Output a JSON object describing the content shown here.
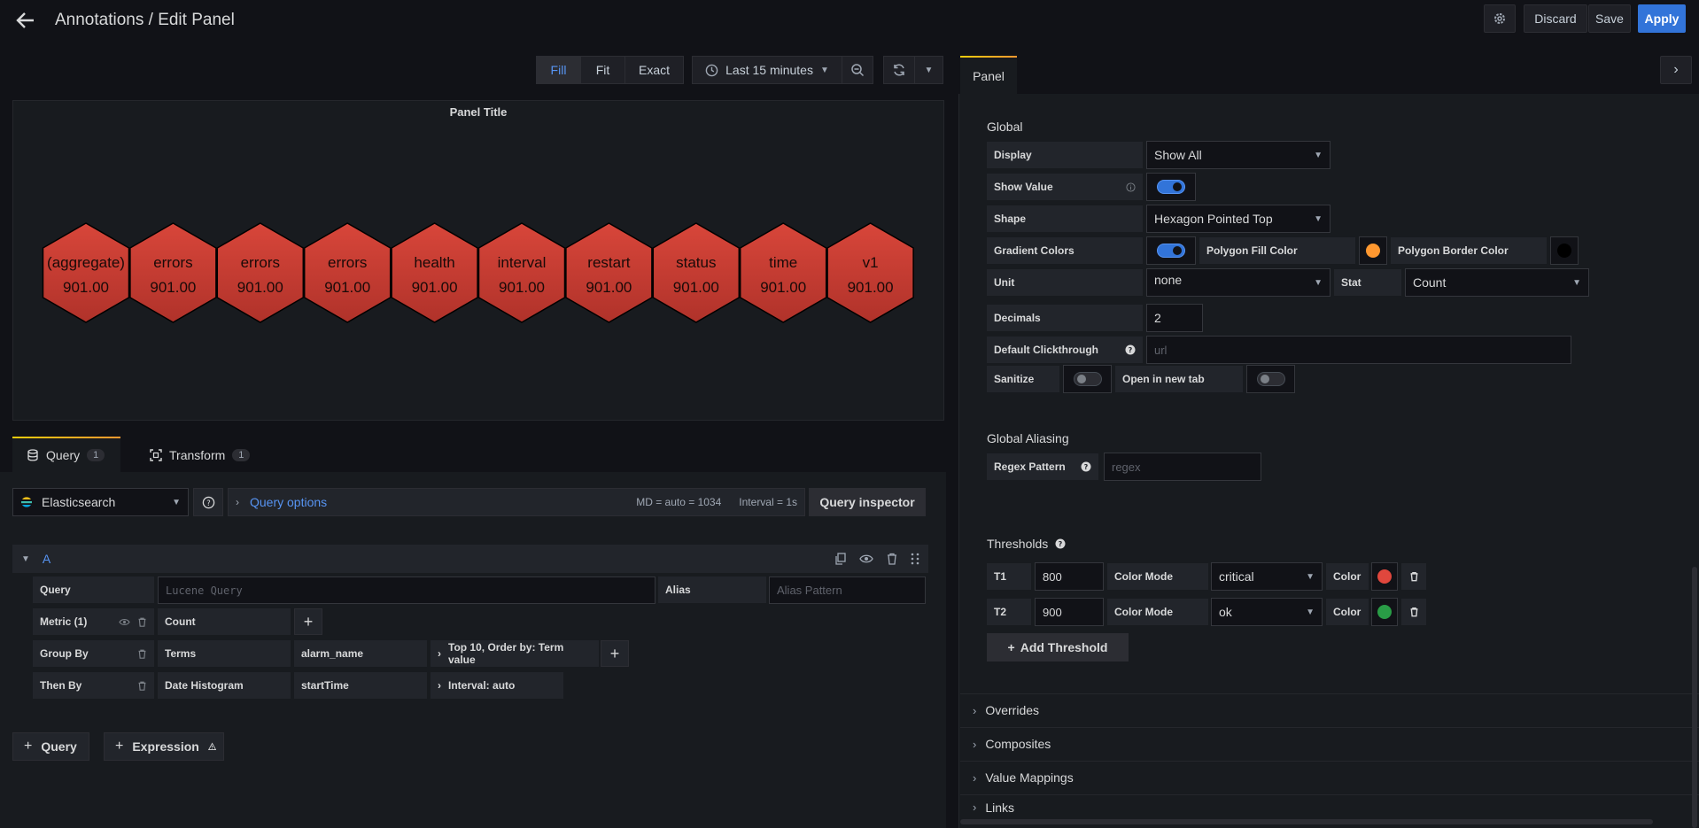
{
  "header": {
    "title": "Annotations / Edit Panel",
    "discard_label": "Discard",
    "save_label": "Save",
    "apply_label": "Apply"
  },
  "toolbar": {
    "fill_label": "Fill",
    "fit_label": "Fit",
    "exact_label": "Exact",
    "time_range": "Last 15 minutes"
  },
  "preview": {
    "title": "Panel Title",
    "hexagons": [
      {
        "label": "(aggregate)",
        "value": "901.00"
      },
      {
        "label": "errors",
        "value": "901.00"
      },
      {
        "label": "errors",
        "value": "901.00"
      },
      {
        "label": "errors",
        "value": "901.00"
      },
      {
        "label": "health",
        "value": "901.00"
      },
      {
        "label": "interval",
        "value": "901.00"
      },
      {
        "label": "restart",
        "value": "901.00"
      },
      {
        "label": "status",
        "value": "901.00"
      },
      {
        "label": "time",
        "value": "901.00"
      },
      {
        "label": "v1",
        "value": "901.00"
      }
    ],
    "hex_color": "#c4382b"
  },
  "query_tabs": {
    "query_label": "Query",
    "query_count": "1",
    "transform_label": "Transform",
    "transform_count": "1"
  },
  "datasource": {
    "name": "Elasticsearch",
    "query_options_label": "Query options",
    "md_info": "MD = auto = 1034",
    "interval_info": "Interval = 1s",
    "inspector_label": "Query inspector"
  },
  "query_a": {
    "ref": "A",
    "query_label": "Query",
    "query_placeholder": "Lucene Query",
    "alias_label": "Alias",
    "alias_placeholder": "Alias Pattern",
    "metric_label": "Metric (1)",
    "metric_value": "Count",
    "group_by_label": "Group By",
    "group_by_type": "Terms",
    "group_by_field": "alarm_name",
    "group_by_options": "Top 10, Order by: Term value",
    "then_by_label": "Then By",
    "then_by_type": "Date Histogram",
    "then_by_field": "startTime",
    "then_by_options": "Interval: auto"
  },
  "add_buttons": {
    "query_label": "Query",
    "expression_label": "Expression"
  },
  "options": {
    "tab_label": "Panel",
    "global_label": "Global",
    "display_label": "Display",
    "display_value": "Show All",
    "show_value_label": "Show Value",
    "shape_label": "Shape",
    "shape_value": "Hexagon Pointed Top",
    "gradient_label": "Gradient Colors",
    "fill_color_label": "Polygon Fill Color",
    "fill_color": "#ff9830",
    "border_color_label": "Polygon Border Color",
    "border_color": "#000000",
    "unit_label": "Unit",
    "unit_value": "none",
    "stat_label": "Stat",
    "stat_value": "Count",
    "decimals_label": "Decimals",
    "decimals_value": "2",
    "clickthrough_label": "Default Clickthrough",
    "clickthrough_placeholder": "url",
    "sanitize_label": "Sanitize",
    "new_tab_label": "Open in new tab",
    "aliasing_label": "Global Aliasing",
    "regex_label": "Regex Pattern",
    "regex_placeholder": "regex",
    "thresholds_label": "Thresholds",
    "thresholds": [
      {
        "name": "T1",
        "value": "800",
        "mode_label": "Color Mode",
        "mode": "critical",
        "color_label": "Color",
        "color": "#e0473d"
      },
      {
        "name": "T2",
        "value": "900",
        "mode_label": "Color Mode",
        "mode": "ok",
        "color_label": "Color",
        "color": "#299c46"
      }
    ],
    "add_threshold_label": "Add Threshold",
    "sections": [
      "Overrides",
      "Composites",
      "Value Mappings",
      "Links"
    ]
  }
}
